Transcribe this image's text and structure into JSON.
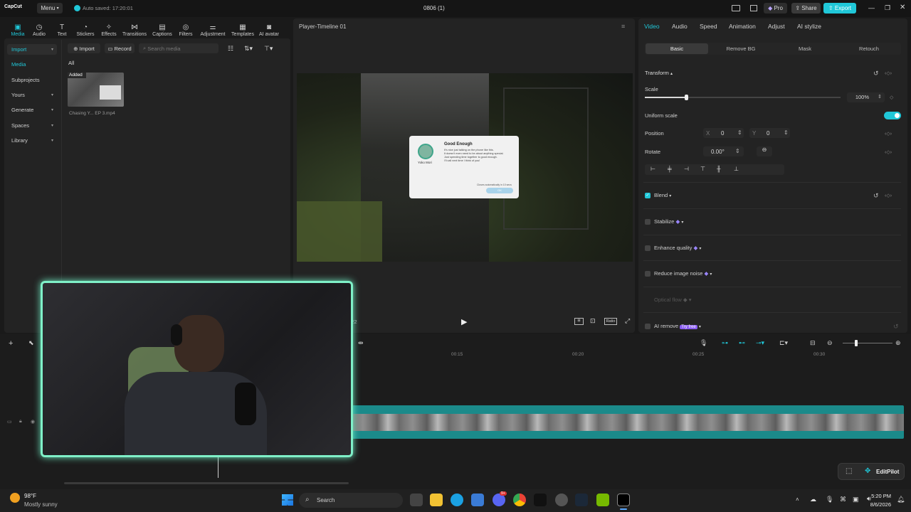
{
  "titlebar": {
    "app_logo": "CapCut",
    "menu_label": "Menu",
    "autosave": "Auto saved: 17:20:01",
    "project_name": "0806 (1)",
    "pro_label": "Pro",
    "share_label": "Share",
    "export_label": "Export",
    "accent": "#20c7d8"
  },
  "tools": [
    {
      "label": "Media",
      "icon": "media-icon"
    },
    {
      "label": "Audio",
      "icon": "audio-icon"
    },
    {
      "label": "Text",
      "icon": "text-icon"
    },
    {
      "label": "Stickers",
      "icon": "sticker-icon"
    },
    {
      "label": "Effects",
      "icon": "effects-icon"
    },
    {
      "label": "Transitions",
      "icon": "transition-icon"
    },
    {
      "label": "Captions",
      "icon": "captions-icon"
    },
    {
      "label": "Filters",
      "icon": "filters-icon"
    },
    {
      "label": "Adjustment",
      "icon": "adjustment-icon"
    },
    {
      "label": "Templates",
      "icon": "templates-icon"
    },
    {
      "label": "AI avatar",
      "icon": "avatar-icon"
    }
  ],
  "media_nav": {
    "import": "Import",
    "media": "Media",
    "subprojects": "Subprojects",
    "yours": "Yours",
    "generate": "Generate",
    "spaces": "Spaces",
    "library": "Library"
  },
  "media_toolbar": {
    "import_btn": "Import",
    "record_btn": "Record",
    "search_placeholder": "Search media",
    "filter_all": "All"
  },
  "media_item": {
    "badge": "Added",
    "filename": "Chasing Y... EP 3.mp4"
  },
  "player": {
    "title": "Player-Timeline 01",
    "time": "0:22",
    "dialog": {
      "heading": "Good Enough",
      "name": "Yoko Mori",
      "lines": [
        "It's nice just talking on the phone like this.",
        "It doesn't even need to be about anything special.",
        "Just spending time together is good enough.",
        "I'll call next time I think of you!"
      ],
      "footer": "Closes automatically in 10 secs",
      "ok": "OK"
    },
    "ratio_label": "Ratio"
  },
  "props": {
    "tabs": [
      "Video",
      "Audio",
      "Speed",
      "Animation",
      "Adjust",
      "AI stylize"
    ],
    "subtabs": [
      "Basic",
      "Remove BG",
      "Mask",
      "Retouch"
    ],
    "transform": "Transform",
    "scale_label": "Scale",
    "scale_value": "100%",
    "scale_level": 0.21,
    "uniform_scale": "Uniform scale",
    "position_label": "Position",
    "pos_x_label": "X",
    "pos_x": "0",
    "pos_y_label": "Y",
    "pos_y": "0",
    "rotate_label": "Rotate",
    "rotate_value": "0.00°",
    "blend": "Blend",
    "stabilize": "Stabilize",
    "enhance_quality": "Enhance quality",
    "reduce_noise": "Reduce image noise",
    "optical_flow": "Optical flow",
    "ai_remove": "AI remove",
    "try_free": "Try free"
  },
  "timeline": {
    "ticks": [
      "00:15",
      "00:20",
      "00:25",
      "00:30"
    ]
  },
  "editpilot": "EditPilot",
  "taskbar": {
    "temp": "98°F",
    "weather": "Mostly sunny",
    "search": "Search",
    "time": "5:20 PM",
    "date": "8/6/2026",
    "badge": "9+"
  }
}
